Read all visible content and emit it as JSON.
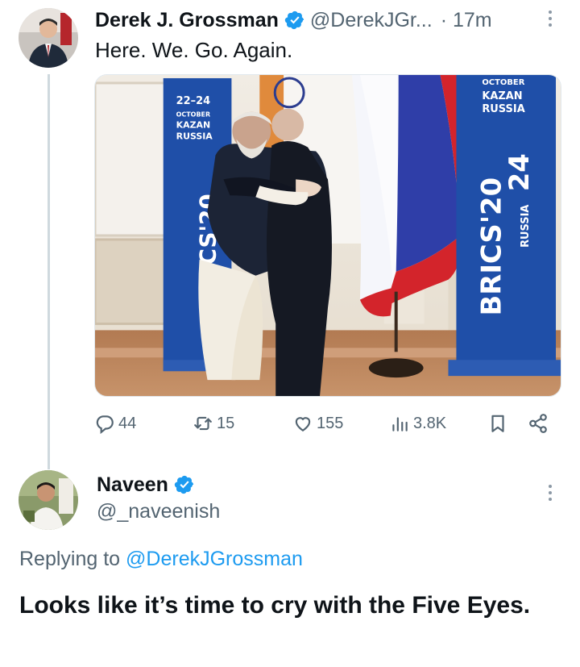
{
  "tweet": {
    "author_name": "Derek J. Grossman",
    "author_handle": "@DerekJGr...",
    "time": "· 17m",
    "text": "Here. We. Go. Again.",
    "media": {
      "banner_left": {
        "dates": "22–24",
        "month": "OCTOBER",
        "city": "KAZAN",
        "country": "RUSSIA",
        "vertical": "BRICS'20"
      },
      "banner_right": {
        "month": "OCTOBER",
        "city": "KAZAN",
        "country": "RUSSIA",
        "vertical": "BRICS'20",
        "vertical_year": "24",
        "vertical_country": "RUSSIA"
      }
    },
    "stats": {
      "replies": "44",
      "retweets": "15",
      "likes": "155",
      "views": "3.8K"
    }
  },
  "reply": {
    "author_name": "Naveen",
    "author_handle": "@_naveenish",
    "replying_prefix": "Replying to",
    "replying_to": "@DerekJGrossman",
    "text": "Looks like it’s time to cry with the Five Eyes."
  },
  "colors": {
    "verified": "#1d9bf0",
    "text_secondary": "#536471",
    "link": "#1d9bf0",
    "banner_blue": "#1f4fa8"
  }
}
